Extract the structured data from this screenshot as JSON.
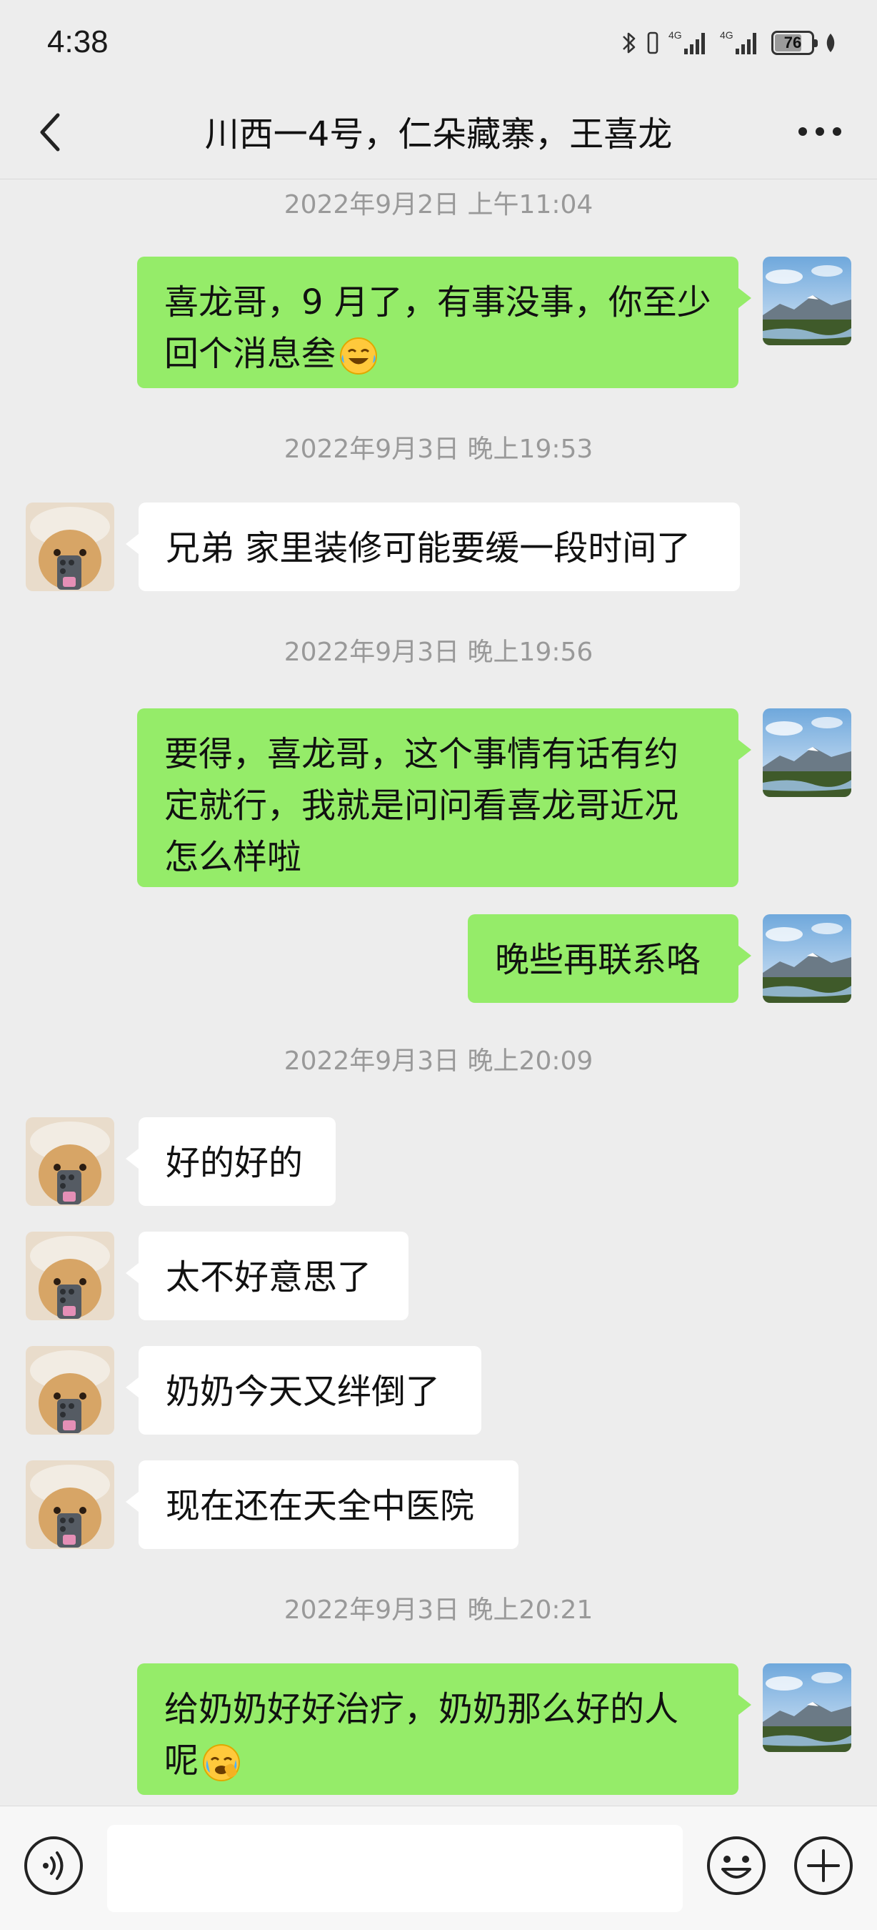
{
  "status_bar": {
    "time": "4:38",
    "network_1": "4G",
    "network_2": "4G",
    "battery_percent": "76",
    "battery_level": 0.76,
    "icons": [
      "bluetooth-icon",
      "signal-icon",
      "signal-icon",
      "battery-icon",
      "leaf-icon"
    ]
  },
  "header": {
    "title": "川西一4号，仁朵藏寨，王喜龙",
    "back_icon": "chevron-left-icon",
    "more_icon": "more-dots-icon"
  },
  "messages": {
    "ts1": "2022年9月2日 上午11:04",
    "m1": "喜龙哥，9 月了，有事没事，你至少回个消息叁",
    "ts2": "2022年9月3日 晚上19:53",
    "m2": "兄弟 家里装修可能要缓一段时间了",
    "ts3": "2022年9月3日 晚上19:56",
    "m3": "要得，喜龙哥，这个事情有话有约定就行，我就是问问看喜龙哥近况怎么样啦",
    "m4": "晚些再联系咯",
    "ts4": "2022年9月3日 晚上20:09",
    "m5": "好的好的",
    "m6": "太不好意思了",
    "m7": "奶奶今天又绊倒了",
    "m8": "现在还在天全中医院",
    "ts5": "2022年9月3日 晚上20:21",
    "m9": "给奶奶好好治疗，奶奶那么好的人呢"
  },
  "input_bar": {
    "voice_icon": "voice-icon",
    "emoji_icon": "emoji-icon",
    "plus_icon": "plus-circle-icon"
  },
  "colors": {
    "background": "#EDEDED",
    "my_bubble": "#95EC69",
    "their_bubble": "#FFFFFF",
    "timestamp": "#999999"
  }
}
